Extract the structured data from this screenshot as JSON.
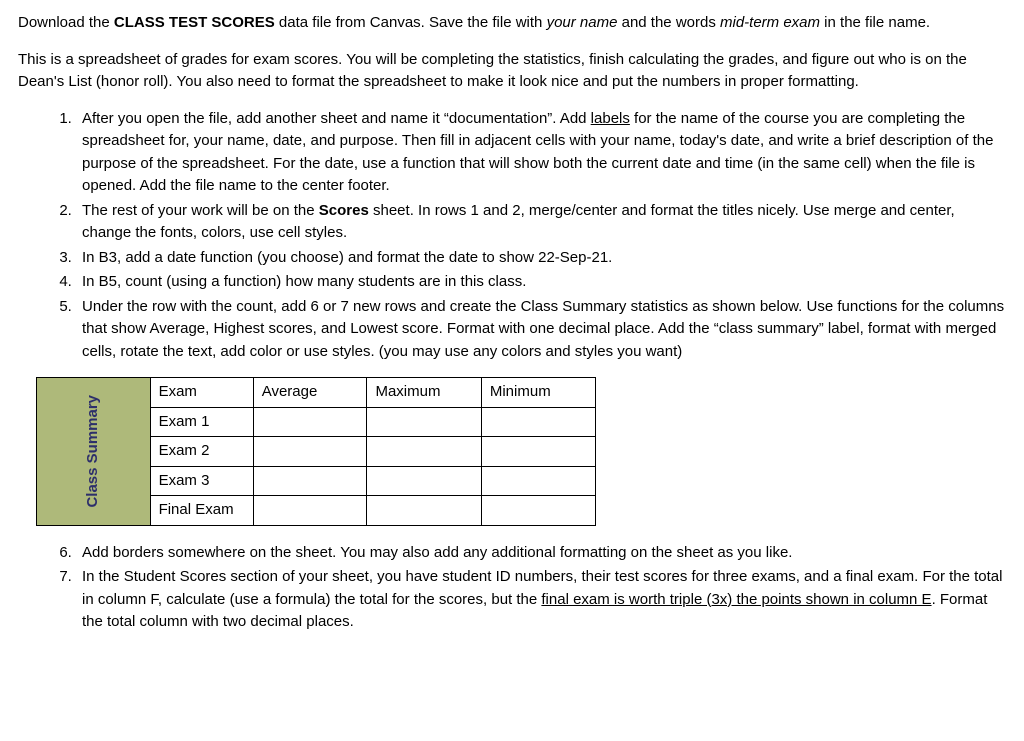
{
  "intro": {
    "p1": {
      "a": "Download the ",
      "bold": "CLASS TEST SCORES",
      "b": " data file from Canvas.  Save the file with ",
      "ital1": "your name",
      "c": " and the words ",
      "ital2": "mid-term exam",
      "d": " in the file name."
    },
    "p2": "This is a spreadsheet of grades for exam scores.  You will be completing the statistics, finish calculating the grades, and figure out who is on the Dean's List (honor roll).  You also need to format the spreadsheet to make it look nice and put the numbers in proper formatting."
  },
  "listA": {
    "i1": {
      "a": "After you open the file, add another sheet and name it “documentation”.  Add ",
      "ul": "labels",
      "b": " for the name of the course you are completing the spreadsheet for, your name, date, and purpose.  Then fill in adjacent cells with your name, today's date, and write a brief description of the purpose of the spreadsheet.  For the date, use a function that will show both the current date and time (in the same cell) when the file is opened.  Add the file name to the center footer."
    },
    "i2": {
      "a": "The rest of your work will be on the ",
      "bold": "Scores",
      "b": " sheet. In rows 1 and 2, merge/center and format the titles nicely.  Use merge and center, change the fonts, colors, use cell styles."
    },
    "i3": "In B3, add a date function (you choose) and format the date to show 22-Sep-21.",
    "i4": "In B5, count (using a function) how many students are in this class.",
    "i5": "Under the row with the count, add 6 or 7 new rows and create the Class Summary statistics as shown below.  Use functions for the columns that show Average, Highest scores, and Lowest score.  Format with one decimal place.  Add the “class summary” label, format with merged cells, rotate the text, add color or use styles.  (you may use any colors and styles you want)"
  },
  "table": {
    "rotated": "Class Summary",
    "header": [
      "Exam",
      "Average",
      "Maximum",
      "Minimum"
    ],
    "rows": [
      "Exam 1",
      "Exam 2",
      "Exam 3",
      "Final Exam"
    ]
  },
  "listB": {
    "i6": "Add borders somewhere on the sheet.  You may also add any additional formatting on the sheet as you like.",
    "i7": {
      "a": "In the Student Scores section of your sheet, you have student ID numbers, their test scores for three exams, and a final exam.  For the total in column F, calculate (use a formula) the total for the scores, but the ",
      "ul1": "final exam is worth triple (3x) the points shown in column E",
      "b": ".  Format the total column with two decimal places."
    }
  }
}
